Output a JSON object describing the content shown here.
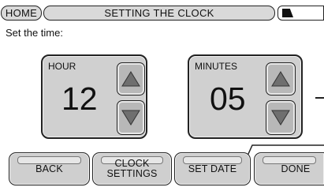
{
  "header": {
    "home_label": "HOME",
    "title": "SETTING THE CLOCK",
    "battery_icon": "battery-icon"
  },
  "subtitle": "Set the time:",
  "hour": {
    "label": "HOUR",
    "value": "12",
    "up_icon": "triangle-up-icon",
    "down_icon": "triangle-down-icon"
  },
  "minutes": {
    "label": "MINUTES",
    "value": "05",
    "up_icon": "triangle-up-icon",
    "down_icon": "triangle-down-icon"
  },
  "buttons": {
    "back": "BACK",
    "clock_settings_line1": "CLOCK",
    "clock_settings_line2": "SETTINGS",
    "set_date": "SET DATE",
    "done": "DONE"
  },
  "colors": {
    "panel": "#d0d0d0",
    "button": "#cfcfcf",
    "arrow": "#6f6f6f"
  }
}
